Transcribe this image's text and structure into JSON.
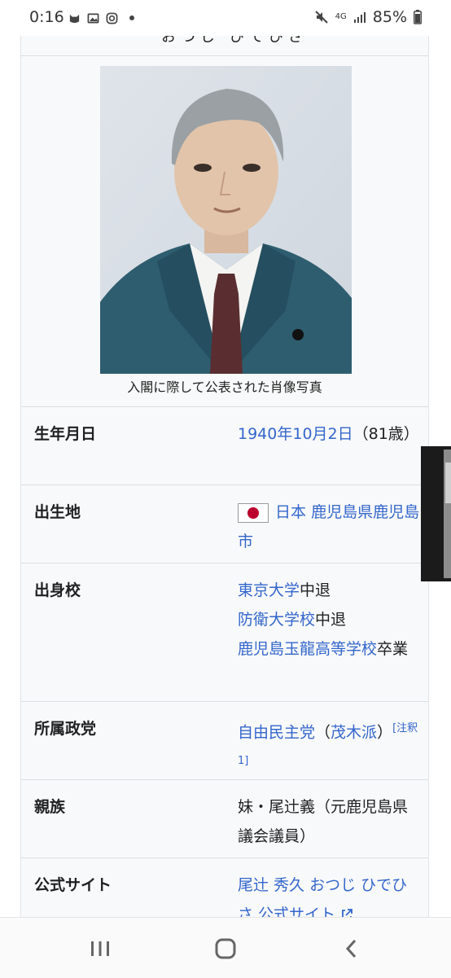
{
  "status_bar": {
    "time": "0:16",
    "network_label": "4G",
    "battery_percent": "85%",
    "icons": [
      "cat-icon",
      "gallery-icon",
      "instagram-icon",
      "dot-icon",
      "mute-icon",
      "signal-icon",
      "battery-icon"
    ]
  },
  "infobox": {
    "title_fragment": "おつじ ひでひさ",
    "photo_caption": "入閣に際して公表された肖像写真",
    "rows": {
      "birthdate": {
        "label": "生年月日",
        "date_link": "1940年10月2日",
        "age": "（81歳）"
      },
      "birthplace": {
        "label": "出生地",
        "country_link": "日本",
        "place_link": "鹿児島県鹿児島市"
      },
      "alma_mater": {
        "label": "出身校",
        "school1_link": "東京大学",
        "school1_status": "中退",
        "school2_link": "防衛大学校",
        "school2_status": "中退",
        "school3_link": "鹿児島玉龍高等学校",
        "school3_status": "卒業"
      },
      "party": {
        "label": "所属政党",
        "party_link": "自由民主党",
        "open_paren": "（",
        "faction_link": "茂木派",
        "close_paren": "）",
        "note": "[注釈 1]"
      },
      "relatives": {
        "label": "親族",
        "value": "妹・尾辻義（元鹿児島県議会議員）"
      },
      "website": {
        "label": "公式サイト",
        "link": "尾辻 秀久 おつじ ひでひさ 公式サイト"
      }
    }
  },
  "colors": {
    "link": "#3366cc",
    "text": "#202122",
    "infobox_bg": "#f8f9fa",
    "flag_red": "#bc002d"
  },
  "navbar": {
    "icons": [
      "recent-apps-icon",
      "home-icon",
      "back-icon"
    ]
  }
}
